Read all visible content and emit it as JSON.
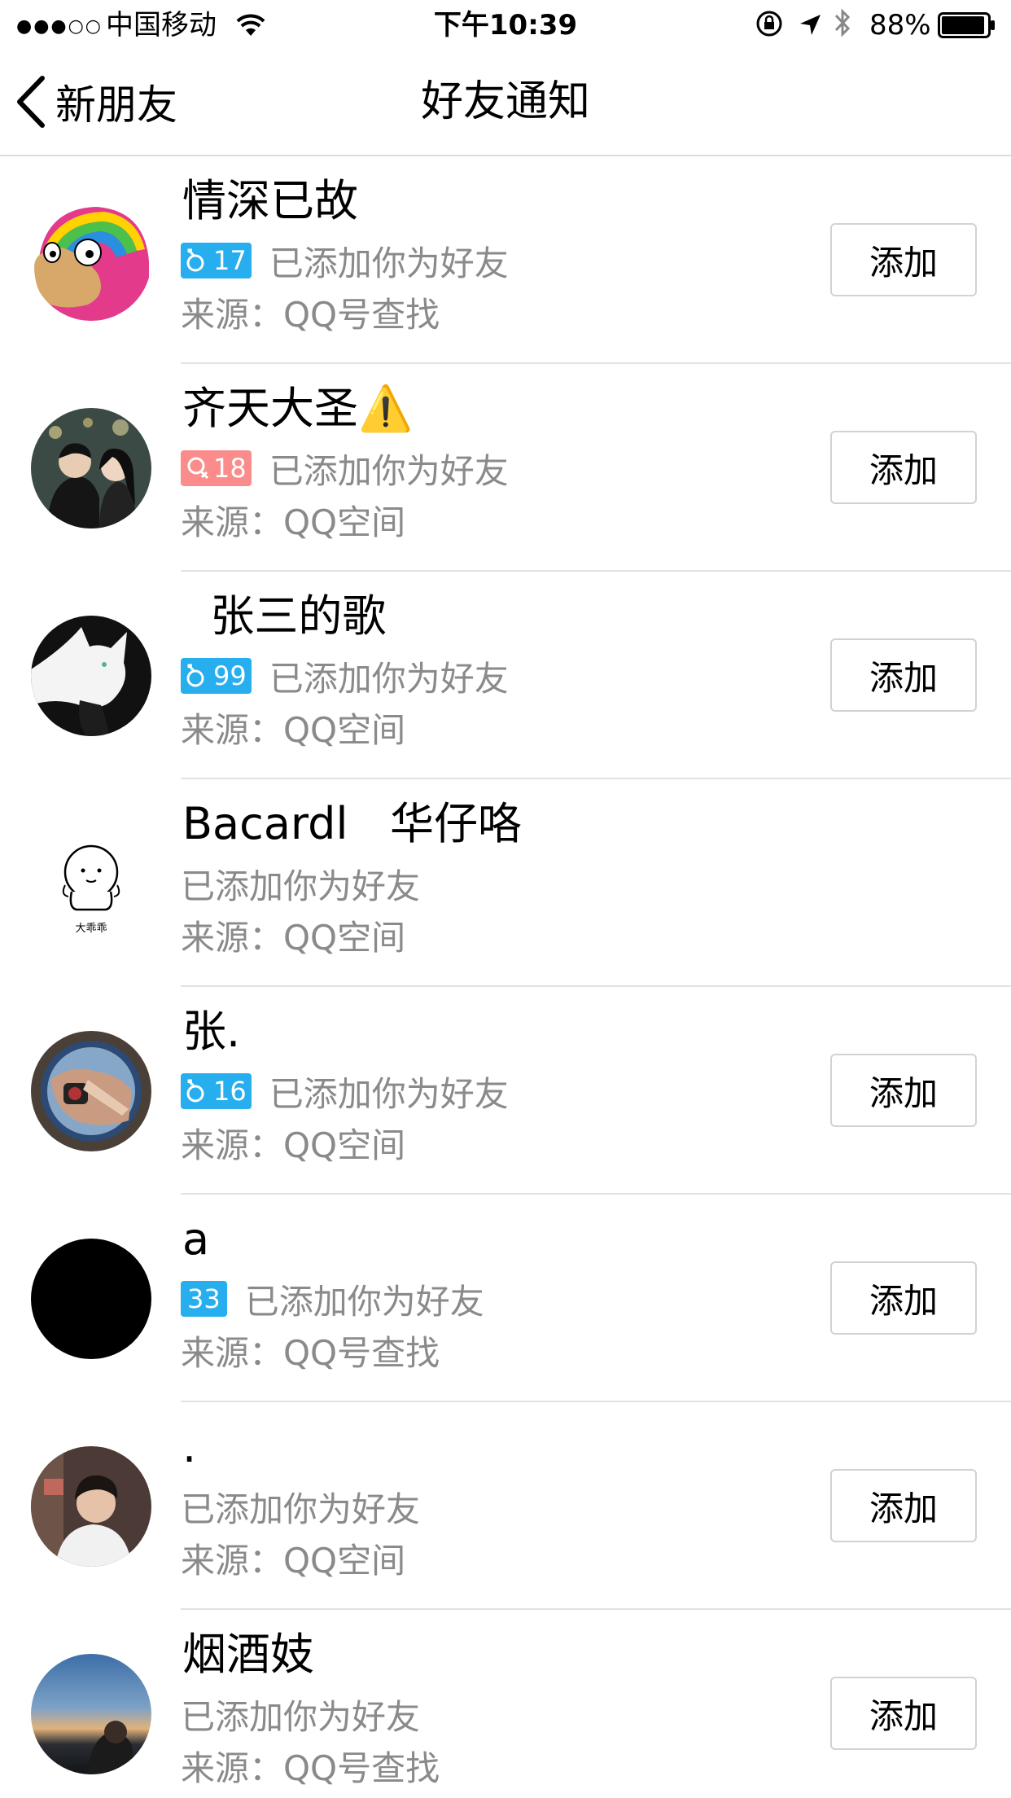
{
  "status_bar": {
    "signal": "●●●○○",
    "carrier": "中国移动",
    "time": "下午10:39",
    "battery": "88%"
  },
  "nav": {
    "back_label": "新朋友",
    "title": "好友通知"
  },
  "add_label": "添加",
  "items": [
    {
      "name": "情深已故",
      "badge": "17",
      "gender": "male",
      "status": "已添加你为好友",
      "source": "来源：QQ号查找",
      "has_add": true,
      "avatar_icon": "rainbow-duck-avatar"
    },
    {
      "name": "齐天大圣⚠️",
      "badge": "18",
      "gender": "female",
      "status": "已添加你为好友",
      "source": "来源：QQ空间",
      "has_add": true,
      "avatar_icon": "couple-photo-avatar"
    },
    {
      "name": "  张三的歌",
      "badge": "99",
      "gender": "male",
      "status": "已添加你为好友",
      "source": "来源：QQ空间",
      "has_add": true,
      "avatar_icon": "white-cat-avatar"
    },
    {
      "name": "Bacardl   华仔咯",
      "badge": "",
      "gender": "",
      "status": "已添加你为好友",
      "source": "来源：QQ空间",
      "has_add": false,
      "avatar_icon": "cartoon-doll-avatar",
      "avatar_caption": "大乖乖"
    },
    {
      "name": "张.",
      "badge": "16",
      "gender": "male",
      "status": "已添加你为好友",
      "source": "来源：QQ空间",
      "has_add": true,
      "avatar_icon": "photo-avatar"
    },
    {
      "name": "a",
      "badge": "33",
      "gender": "none",
      "status": "已添加你为好友",
      "source": "来源：QQ号查找",
      "has_add": true,
      "avatar_icon": "black-circle-avatar"
    },
    {
      "name": ".",
      "badge": "",
      "gender": "",
      "status": "已添加你为好友",
      "source": "来源：QQ空间",
      "has_add": true,
      "avatar_icon": "boy-photo-avatar"
    },
    {
      "name": "烟酒妓",
      "badge": "",
      "gender": "",
      "status": "已添加你为好友",
      "source": "来源：QQ号查找",
      "has_add": true,
      "avatar_icon": "sunset-photo-avatar"
    }
  ],
  "colors": {
    "male_badge": "#27aeee",
    "female_badge": "#fa8d8b",
    "secondary_text": "#8a8a8a",
    "separator": "#e2e2e2"
  }
}
